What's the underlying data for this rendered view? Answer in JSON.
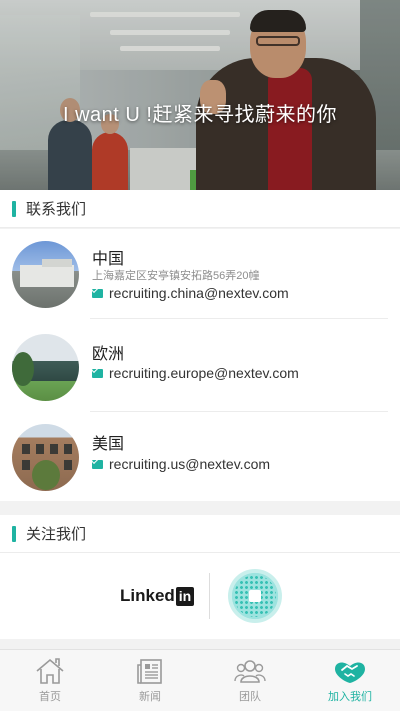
{
  "hero": {
    "title": "I want U !赶紧来寻找蔚来的你"
  },
  "contact_section": {
    "title": "联系我们",
    "items": [
      {
        "region": "中国",
        "address": "上海嘉定区安亭镇安拓路56弄20幢",
        "email": "recruiting.china@nextev.com"
      },
      {
        "region": "欧洲",
        "address": "",
        "email": "recruiting.europe@nextev.com"
      },
      {
        "region": "美国",
        "address": "",
        "email": "recruiting.us@nextev.com"
      }
    ]
  },
  "follow_section": {
    "title": "关注我们",
    "linkedin_text": "Linked",
    "linkedin_badge": "in"
  },
  "tabs": [
    {
      "label": "首页",
      "icon": "home-icon",
      "active": false
    },
    {
      "label": "新闻",
      "icon": "news-icon",
      "active": false
    },
    {
      "label": "团队",
      "icon": "team-icon",
      "active": false
    },
    {
      "label": "加入我们",
      "icon": "join-us-icon",
      "active": true
    }
  ],
  "colors": {
    "accent": "#1fb3a2",
    "inactive": "#9a9a9a"
  }
}
